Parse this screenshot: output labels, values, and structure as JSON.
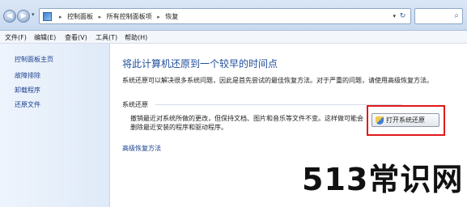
{
  "address_bar": {
    "crumbs": [
      "控制面板",
      "所有控制面板项",
      "恢复"
    ]
  },
  "menu": {
    "items": [
      "文件(F)",
      "编辑(E)",
      "查看(V)",
      "工具(T)",
      "帮助(H)"
    ]
  },
  "sidebar": {
    "items": [
      {
        "label": "控制面板主页"
      },
      {
        "label": "故障排除"
      },
      {
        "label": "卸载程序"
      },
      {
        "label": "还原文件"
      }
    ]
  },
  "main": {
    "title": "将此计算机还原到一个较早的时间点",
    "description": "系统还原可以解决很多系统问题，因此是首先尝试的最佳恢复方法。对于严重的问题，请使用高级恢复方法。",
    "section_title": "系统还原",
    "section_text": "撤销最近对系统所做的更改，但保持文档、图片和音乐等文件不变。这样做可能会删除最近安装的程序和驱动程序。",
    "open_button_label": "打开系统还原",
    "advanced_link": "高级恢复方法"
  },
  "watermark": "513常识网",
  "colors": {
    "highlight": "#e0191b",
    "link": "#1a3f8c",
    "title": "#1f4e9b"
  },
  "icons": {
    "back": "back-arrow-icon",
    "forward": "forward-arrow-icon",
    "refresh": "refresh-icon",
    "search": "search-icon",
    "shield": "uac-shield-icon"
  }
}
